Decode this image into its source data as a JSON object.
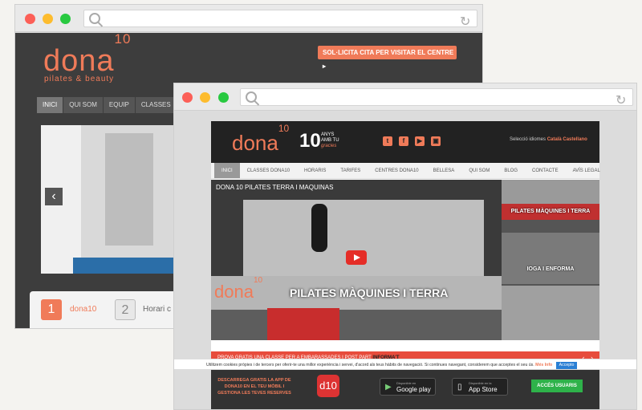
{
  "back_window": {
    "logo": "dona",
    "logo_sup": "10",
    "tagline": "pilates & beauty",
    "cta": "SOL·LICITA CITA PER VISITAR EL CENTRE",
    "nav": [
      "INICI",
      "QUI SOM",
      "EQUIP",
      "CLASSES"
    ],
    "steps": [
      {
        "num": "1",
        "label": "dona10"
      },
      {
        "num": "2",
        "label": "Horari c"
      }
    ]
  },
  "front_window": {
    "logo": "dona",
    "logo_sup": "10",
    "anniversary_num": "10",
    "anniversary_text": [
      "ANYS",
      "AMB TU",
      "gracies"
    ],
    "social_icons": [
      "twitter-icon",
      "facebook-icon",
      "youtube-icon",
      "instagram-icon"
    ],
    "lang_label": "Selecció idiomes",
    "lang_options": [
      "Català",
      "Castellano"
    ],
    "nav": [
      "INICI",
      "CLASSES DONA10",
      "HORARIS",
      "TARIFES",
      "CENTRES DONA10",
      "BELLESA",
      "QUI SOM",
      "BLOG",
      "CONTACTE",
      "AVÍS LEGAL"
    ],
    "video": {
      "title": "DONA 10 PILATES TERRA I MAQUINAS",
      "overlay_logo": "dona",
      "overlay_sup": "10",
      "overlay_text": "PILATES MÀQUINES I TERRA"
    },
    "thumbnails": [
      "",
      "PILATES MÀQUINES I TERRA",
      "IOGA I ENFORMA",
      ""
    ],
    "promo": {
      "text": "PROVA GRATIS UNA CLASSE PER A EMBARASSADES I POST PART",
      "link": "INFORMA'T"
    },
    "footer": {
      "app_text": "DESCARREGA GRATIS LA APP DE DONA10 EN EL TEU MÒBIL I GESTIONA LES TEVES RESERVES",
      "app_icon": "d10",
      "google": {
        "small": "Disponible en",
        "big": "Google play"
      },
      "apple": {
        "small": "Disponible en la",
        "big": "App Store"
      },
      "users_button": "ACCÉS USUARIS"
    }
  },
  "cookie": {
    "text": "Utilitzem cookies pròpies i de tercers per oferir-te una millor experiència i servei, d'acord als teus hàbits de navegació. Si continues navegant, considerem que acceptes el seu ús.",
    "more": "Més Info",
    "accept": "Accepto"
  },
  "colors": {
    "accent": "#f07b59",
    "promo": "#e74c3c",
    "green": "#2eb24a"
  }
}
